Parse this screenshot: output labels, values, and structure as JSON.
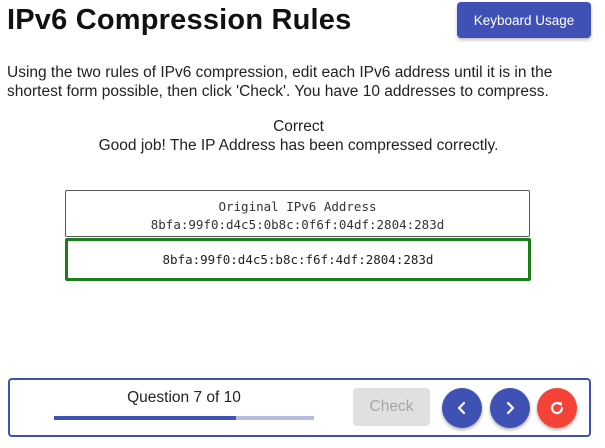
{
  "header": {
    "title": "IPv6 Compression Rules",
    "keyboard_button": "Keyboard Usage"
  },
  "instructions": "Using the two rules of IPv6 compression, edit each IPv6 address until it is in the shortest form possible, then click 'Check'. You have 10 addresses to compress.",
  "status": {
    "heading": "Correct",
    "message": "Good job! The IP Address has been compressed correctly."
  },
  "original": {
    "label": "Original IPv6 Address",
    "address": "8bfa:99f0:d4c5:0b8c:0f6f:04df:2804:283d"
  },
  "answer": {
    "value": "8bfa:99f0:d4c5:b8c:f6f:4df:2804:283d"
  },
  "footer": {
    "question_label": "Question 7 of 10",
    "progress": 0.7,
    "check_label": "Check"
  },
  "icons": {
    "prev": "chevron-left-icon",
    "next": "chevron-right-icon",
    "reset": "refresh-icon"
  },
  "colors": {
    "primary": "#3f51b5",
    "correct_border": "#1a7f1a",
    "reset": "#f44336",
    "disabled_bg": "#e0e0e0"
  }
}
